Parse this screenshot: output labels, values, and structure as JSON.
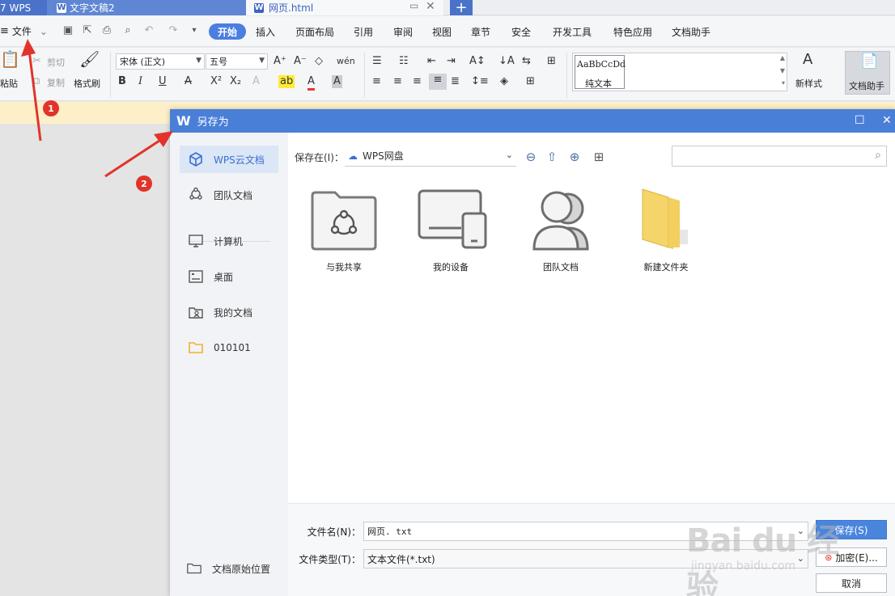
{
  "tabs": {
    "wps": "WPS",
    "doc2": "文字文稿2",
    "web": "网页.html",
    "new_tab": "+"
  },
  "menu": {
    "file": "文件",
    "start": "开始",
    "items": [
      "插入",
      "页面布局",
      "引用",
      "审阅",
      "视图",
      "章节",
      "安全",
      "开发工具",
      "特色应用",
      "文档助手"
    ]
  },
  "ribbon": {
    "paste": "粘贴",
    "cut": "剪切",
    "copy": "复制",
    "format_painter": "格式刷",
    "font_name": "宋体 (正文)",
    "font_size": "五号",
    "style_sample": "AaBbCcDd",
    "style_name": "纯文本",
    "new_style": "新样式",
    "doc_helper": "文档助手"
  },
  "dialog": {
    "title": "另存为",
    "sidebar": {
      "wps_cloud": "WPS云文档",
      "team_docs": "团队文档",
      "computer": "计算机",
      "desktop": "桌面",
      "my_docs": "我的文档",
      "folder_010101": "010101",
      "original_location": "文档原始位置"
    },
    "save_in_label": "保存在(I)：",
    "save_in_value": "WPS网盘",
    "search_placeholder": "",
    "files": [
      {
        "name": "与我共享",
        "icon": "shared-folder-icon"
      },
      {
        "name": "我的设备",
        "icon": "devices-icon"
      },
      {
        "name": "团队文档",
        "icon": "team-icon"
      },
      {
        "name": "新建文件夹",
        "icon": "folder-icon"
      }
    ],
    "filename_label": "文件名(N)：",
    "filename_value": "网页. txt",
    "filetype_label": "文件类型(T)：",
    "filetype_value": "文本文件(*.txt)",
    "save_button": "保存(S)",
    "encrypt_button": "加密(E)...",
    "cancel_button": "取消"
  },
  "annotations": {
    "step1": "1",
    "step2": "2",
    "arrow_color": "#e2332a"
  },
  "watermark": {
    "main": "Bai du 经验",
    "sub": "jingyan.baidu.com"
  },
  "colors": {
    "accent": "#4a7fd8",
    "tab_active": "#3b63c0",
    "folder": "#f5c542"
  }
}
